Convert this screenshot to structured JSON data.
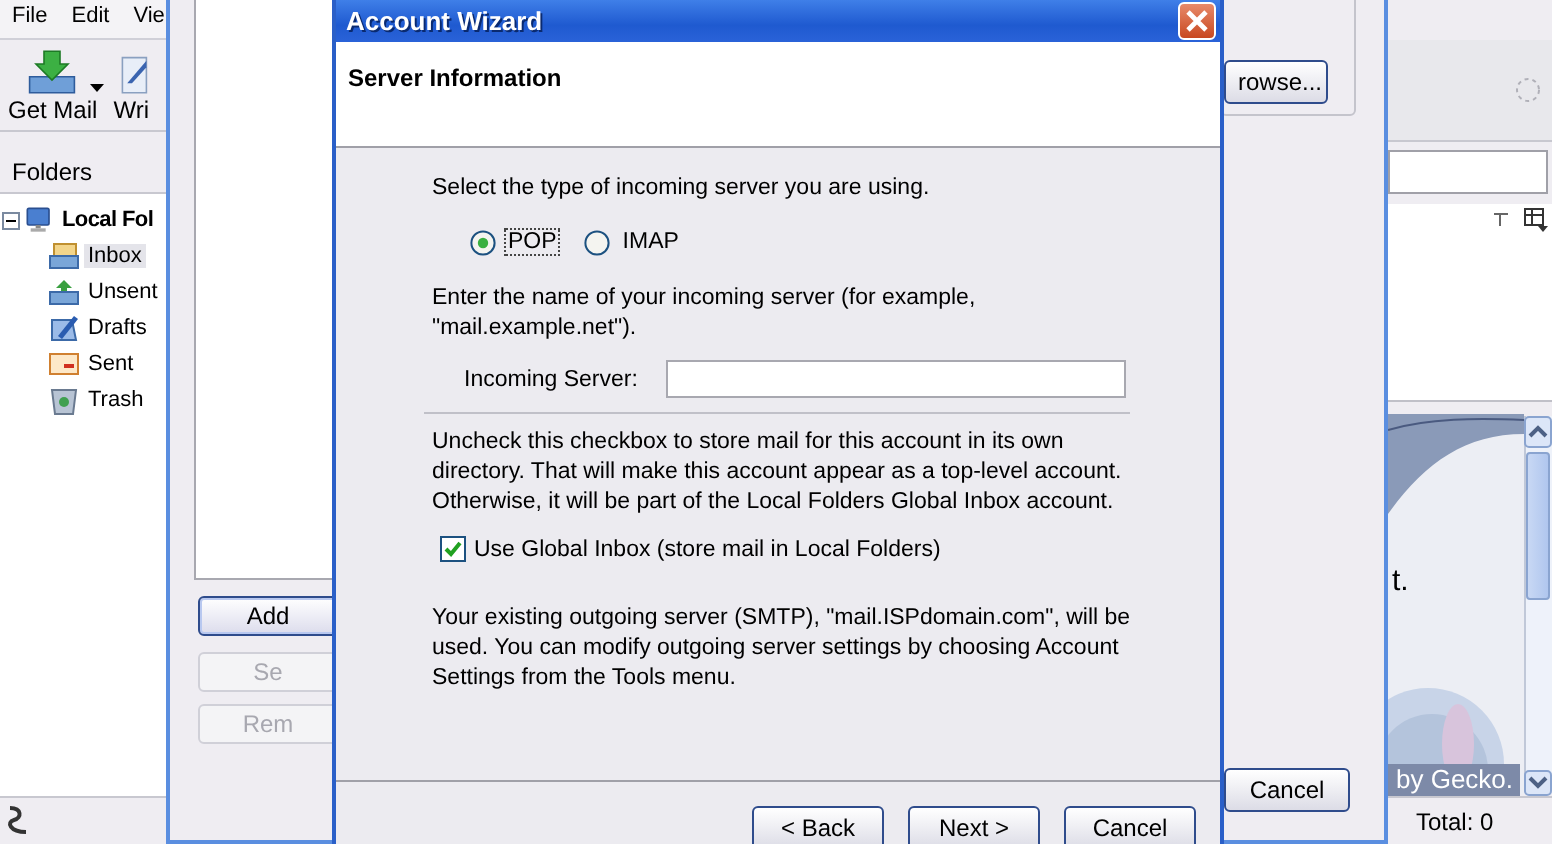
{
  "main_window": {
    "menu": [
      "File",
      "Edit",
      "Vie"
    ],
    "toolbar": [
      {
        "label": "Get Mail",
        "kind": "get-mail"
      },
      {
        "label": "Wri",
        "kind": "write"
      }
    ],
    "folders_header": "Folders",
    "folder_tree": [
      {
        "label": "Local Fol",
        "kind": "computer",
        "expanded": true,
        "children": [
          {
            "label": "Inbox",
            "kind": "inbox",
            "selected": true
          },
          {
            "label": "Unsent",
            "kind": "unsent",
            "selected": false
          },
          {
            "label": "Drafts",
            "kind": "drafts",
            "selected": false
          },
          {
            "label": "Sent",
            "kind": "sent",
            "selected": false
          },
          {
            "label": "Trash",
            "kind": "trash",
            "selected": false
          }
        ]
      }
    ],
    "message_pane": {
      "text_fragment": "t.",
      "banner": "by Gecko."
    },
    "status_bar": {
      "total": "Total: 0"
    }
  },
  "account_settings": {
    "buttons": [
      {
        "label": "Add",
        "focused": true,
        "disabled": false
      },
      {
        "label": "Se",
        "focused": false,
        "disabled": true
      },
      {
        "label": "Rem",
        "focused": false,
        "disabled": true
      }
    ],
    "browse_button": "rowse...",
    "cancel_button": "Cancel"
  },
  "wizard": {
    "title": "Account Wizard",
    "heading": "Server Information",
    "server_type_prompt": "Select the type of incoming server you are using.",
    "server_types": [
      {
        "label": "POP",
        "selected": true
      },
      {
        "label": "IMAP",
        "selected": false
      }
    ],
    "server_name_prompt": "Enter the name of your incoming server (for example, \"mail.example.net\").",
    "incoming_server": {
      "label": "Incoming Server:"
    },
    "global_inbox_note": "Uncheck this checkbox to store mail for this account in its own directory. That will make this account appear as a top-level account. Otherwise, it will be part of the Local Folders Global Inbox account.",
    "use_global_inbox": {
      "label": "Use Global Inbox (store mail in Local Folders)",
      "checked": true
    },
    "smtp_note": "Your existing outgoing server (SMTP), \"mail.ISPdomain.com\", will be used. You can modify outgoing server settings by choosing Account Settings from the Tools menu.",
    "buttons": [
      "< Back",
      "Next >",
      "Cancel"
    ]
  }
}
